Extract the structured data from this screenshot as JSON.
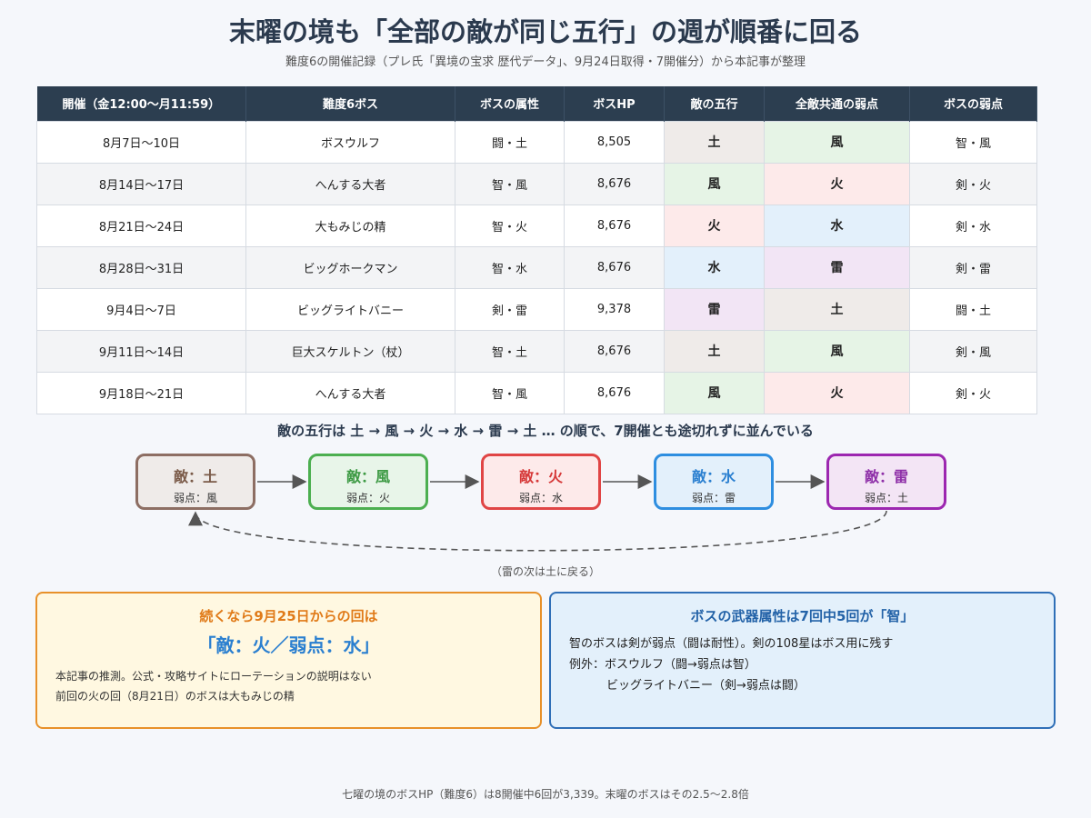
{
  "title": "末曜の境も「全部の敵が同じ五行」の週が順番に回る",
  "subtitle": "難度6の開催記録（プレ氏「異境の宝求 歴代データ」、9月24日取得・7開催分）から本記事が整理",
  "table": {
    "headers": [
      "開催（金12:00〜月11:59）",
      "難度6ボス",
      "ボスの属性",
      "ボスHP",
      "敵の五行",
      "全敵共通の弱点",
      "ボスの弱点"
    ],
    "rows": [
      {
        "period": "8月7日〜10日",
        "boss": "ボスウルフ",
        "attr": "闘・土",
        "hp": "8,505",
        "enemy": "土",
        "weak": "風",
        "boss_weak": "智・風"
      },
      {
        "period": "8月14日〜17日",
        "boss": "へんする大者",
        "attr": "智・風",
        "hp": "8,676",
        "enemy": "風",
        "weak": "火",
        "boss_weak": "剣・火"
      },
      {
        "period": "8月21日〜24日",
        "boss": "大もみじの精",
        "attr": "智・火",
        "hp": "8,676",
        "enemy": "火",
        "weak": "水",
        "boss_weak": "剣・水"
      },
      {
        "period": "8月28日〜31日",
        "boss": "ビッグホークマン",
        "attr": "智・水",
        "hp": "8,676",
        "enemy": "水",
        "weak": "雷",
        "boss_weak": "剣・雷"
      },
      {
        "period": "9月4日〜7日",
        "boss": "ビッグライトバニー",
        "attr": "剣・雷",
        "hp": "9,378",
        "enemy": "雷",
        "weak": "土",
        "boss_weak": "闘・土"
      },
      {
        "period": "9月11日〜14日",
        "boss": "巨大スケルトン（杖）",
        "attr": "智・土",
        "hp": "8,676",
        "enemy": "土",
        "weak": "風",
        "boss_weak": "剣・風"
      },
      {
        "period": "9月18日〜21日",
        "boss": "へんする大者",
        "attr": "智・風",
        "hp": "8,676",
        "enemy": "風",
        "weak": "火",
        "boss_weak": "剣・火"
      }
    ]
  },
  "element_colors": {
    "土": "#7a5a48",
    "風": "#3d9a44",
    "火": "#d63a3a",
    "水": "#2a7fd0",
    "雷": "#8e2fa8"
  },
  "cycle": {
    "caption": "敵の五行は 土 → 風 → 火 → 水 → 雷 → 土 … の順で、7開催とも途切れずに並んでいる",
    "nodes": [
      {
        "main": "敵：土",
        "sub": "弱点：風"
      },
      {
        "main": "敵：風",
        "sub": "弱点：火"
      },
      {
        "main": "敵：火",
        "sub": "弱点：水"
      },
      {
        "main": "敵：水",
        "sub": "弱点：雷"
      },
      {
        "main": "敵：雷",
        "sub": "弱点：土"
      }
    ],
    "loop_caption": "（雷の次は土に戻る）"
  },
  "prediction": {
    "heading": "続くなら9月25日からの回は",
    "big": "「敵：火／弱点：水」",
    "note1": "本記事の推測。公式・攻略サイトにローテーションの説明はない",
    "note2": "前回の火の回（8月21日）のボスは大もみじの精"
  },
  "weapon": {
    "heading": "ボスの武器属性は7回中5回が「智」",
    "line1": "智のボスは剣が弱点（闘は耐性）。剣の108星はボス用に残す",
    "line2": "例外：ボスウルフ（闘→弱点は智）",
    "line3": "ビッグライトバニー（剣→弱点は闘）"
  },
  "footer": "七曜の境のボスHP（難度6）は8開催中6回が3,339。末曜のボスはその2.5〜2.8倍"
}
